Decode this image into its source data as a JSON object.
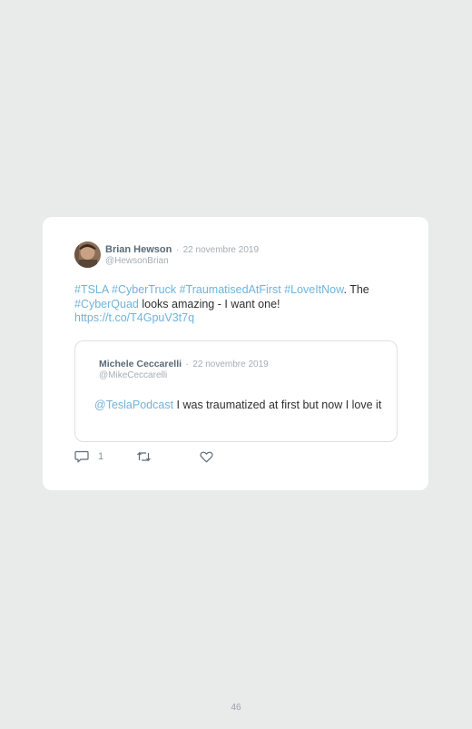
{
  "tweet": {
    "author_name": "Brian Hewson",
    "separator": "·",
    "date": "22 novembre 2019",
    "handle": "@HewsonBrian",
    "text_parts": {
      "tag1": "#TSLA",
      "tag2": "#CyberTruck",
      "tag3": "#TraumatisedAtFirst",
      "tag4": "#LoveItNow",
      "plain1": ". The",
      "tag5": "#CyberQuad",
      "plain2": " looks amazing - I want one!",
      "url": "https://t.co/T4GpuV3t7q"
    }
  },
  "quoted_tweet": {
    "author_name": "Michele Ceccarelli",
    "separator": "·",
    "date": "22 novembre 2019",
    "handle": "@MikeCeccarelli",
    "mention": "@TeslaPodcast",
    "text": " I was traumatized at first but now I love it"
  },
  "actions": {
    "reply_count": "1"
  },
  "page_number": "46",
  "colors": {
    "background": "#e9eaea",
    "card": "#ffffff",
    "link": "#6fb3dd",
    "author": "#596a78",
    "muted": "#a5adb4"
  },
  "icons": {
    "reply": "reply-icon",
    "retweet": "retweet-icon",
    "like": "heart-icon"
  }
}
